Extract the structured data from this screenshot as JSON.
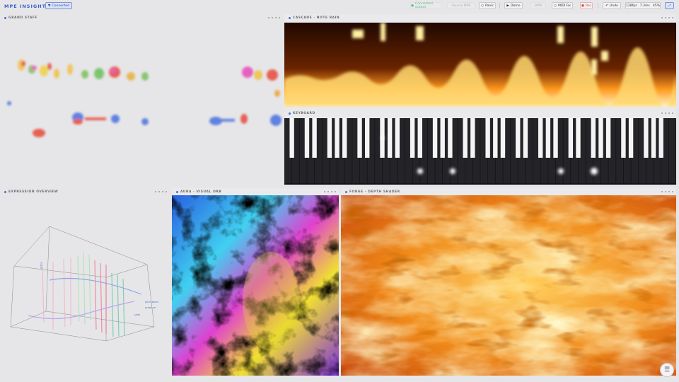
{
  "app": {
    "title": "MPE INSIGHT"
  },
  "toolbar": {
    "connected_label": "Connected",
    "status_label": "Connected output",
    "source_label": "Source MPE",
    "panic_label": "Panic",
    "demo_label": "Demo",
    "bpm_label": "BPM",
    "midi_fix_label": "MIDI Fix",
    "rec_label": "Rec",
    "undo_label": "Undo",
    "stats": [
      "128fps",
      "7.3ms",
      "45%"
    ]
  },
  "panels": {
    "grand_staff": {
      "title": "GRAND STAFF"
    },
    "cascade": {
      "title": "CASCADE · NOTE RAIN"
    },
    "keyboard": {
      "title": "KEYBOARD"
    },
    "expression": {
      "title": "EXPRESSION OVERVIEW",
      "axis_label": "PITCH",
      "readouts": [
        "pitch bend",
        "pressure",
        "slide"
      ]
    },
    "aura": {
      "title": "AURA · VISUAL ORB"
    },
    "forge": {
      "title": "FORGE · DEPTH SHADER"
    }
  },
  "icons": [
    "connected-icon",
    "panic-icon",
    "play-icon",
    "midi-icon",
    "record-icon",
    "undo-icon",
    "fullscreen-icon",
    "menu-icon"
  ],
  "colors": {
    "accent": "#3a5fcf",
    "record": "#e04848",
    "ok": "#5fc07a"
  }
}
